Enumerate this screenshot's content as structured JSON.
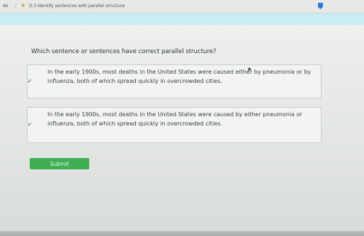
{
  "topbar": {
    "grade": "de",
    "separator": "|",
    "star_icon": "★",
    "title": "O.3 Identify sentences with parallel structure"
  },
  "question": {
    "prompt": "Which sentence or sentences have correct parallel structure?"
  },
  "options": [
    {
      "check": "✓",
      "text": "In the early 1900s, most deaths in the United States were caused either by pneumonia or by influenza, both of which spread quickly in overcrowded cities."
    },
    {
      "check": "✓",
      "text": "In the early 1900s, most deaths in the United States were caused by either pneumonia or influenza, both of which spread quickly in overcrowded cities."
    }
  ],
  "submit": {
    "label": "Submit"
  },
  "colors": {
    "accent": "#3fae54",
    "band": "#c9eef4",
    "marker": "#2f78d8"
  }
}
